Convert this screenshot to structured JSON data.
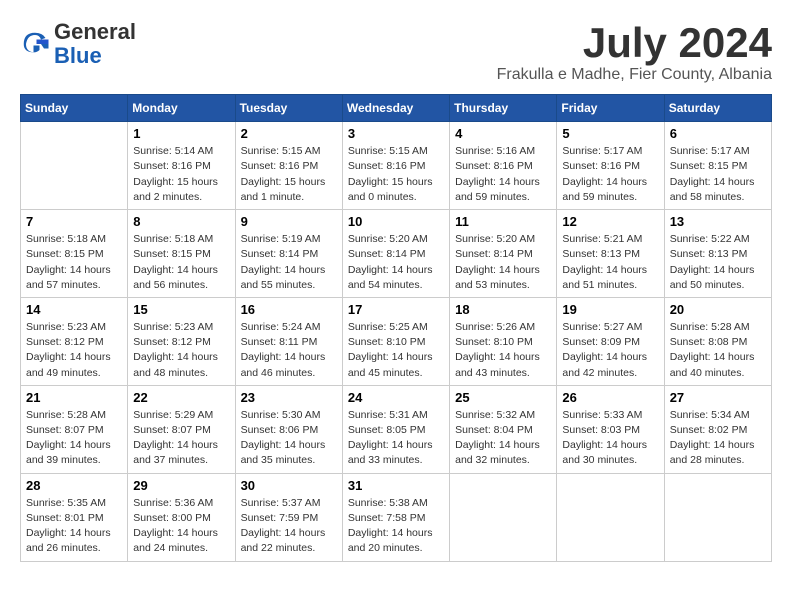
{
  "header": {
    "logo_general": "General",
    "logo_blue": "Blue",
    "month": "July 2024",
    "location": "Frakulla e Madhe, Fier County, Albania"
  },
  "days_of_week": [
    "Sunday",
    "Monday",
    "Tuesday",
    "Wednesday",
    "Thursday",
    "Friday",
    "Saturday"
  ],
  "weeks": [
    [
      {
        "day": "",
        "info": ""
      },
      {
        "day": "1",
        "info": "Sunrise: 5:14 AM\nSunset: 8:16 PM\nDaylight: 15 hours\nand 2 minutes."
      },
      {
        "day": "2",
        "info": "Sunrise: 5:15 AM\nSunset: 8:16 PM\nDaylight: 15 hours\nand 1 minute."
      },
      {
        "day": "3",
        "info": "Sunrise: 5:15 AM\nSunset: 8:16 PM\nDaylight: 15 hours\nand 0 minutes."
      },
      {
        "day": "4",
        "info": "Sunrise: 5:16 AM\nSunset: 8:16 PM\nDaylight: 14 hours\nand 59 minutes."
      },
      {
        "day": "5",
        "info": "Sunrise: 5:17 AM\nSunset: 8:16 PM\nDaylight: 14 hours\nand 59 minutes."
      },
      {
        "day": "6",
        "info": "Sunrise: 5:17 AM\nSunset: 8:15 PM\nDaylight: 14 hours\nand 58 minutes."
      }
    ],
    [
      {
        "day": "7",
        "info": "Sunrise: 5:18 AM\nSunset: 8:15 PM\nDaylight: 14 hours\nand 57 minutes."
      },
      {
        "day": "8",
        "info": "Sunrise: 5:18 AM\nSunset: 8:15 PM\nDaylight: 14 hours\nand 56 minutes."
      },
      {
        "day": "9",
        "info": "Sunrise: 5:19 AM\nSunset: 8:14 PM\nDaylight: 14 hours\nand 55 minutes."
      },
      {
        "day": "10",
        "info": "Sunrise: 5:20 AM\nSunset: 8:14 PM\nDaylight: 14 hours\nand 54 minutes."
      },
      {
        "day": "11",
        "info": "Sunrise: 5:20 AM\nSunset: 8:14 PM\nDaylight: 14 hours\nand 53 minutes."
      },
      {
        "day": "12",
        "info": "Sunrise: 5:21 AM\nSunset: 8:13 PM\nDaylight: 14 hours\nand 51 minutes."
      },
      {
        "day": "13",
        "info": "Sunrise: 5:22 AM\nSunset: 8:13 PM\nDaylight: 14 hours\nand 50 minutes."
      }
    ],
    [
      {
        "day": "14",
        "info": "Sunrise: 5:23 AM\nSunset: 8:12 PM\nDaylight: 14 hours\nand 49 minutes."
      },
      {
        "day": "15",
        "info": "Sunrise: 5:23 AM\nSunset: 8:12 PM\nDaylight: 14 hours\nand 48 minutes."
      },
      {
        "day": "16",
        "info": "Sunrise: 5:24 AM\nSunset: 8:11 PM\nDaylight: 14 hours\nand 46 minutes."
      },
      {
        "day": "17",
        "info": "Sunrise: 5:25 AM\nSunset: 8:10 PM\nDaylight: 14 hours\nand 45 minutes."
      },
      {
        "day": "18",
        "info": "Sunrise: 5:26 AM\nSunset: 8:10 PM\nDaylight: 14 hours\nand 43 minutes."
      },
      {
        "day": "19",
        "info": "Sunrise: 5:27 AM\nSunset: 8:09 PM\nDaylight: 14 hours\nand 42 minutes."
      },
      {
        "day": "20",
        "info": "Sunrise: 5:28 AM\nSunset: 8:08 PM\nDaylight: 14 hours\nand 40 minutes."
      }
    ],
    [
      {
        "day": "21",
        "info": "Sunrise: 5:28 AM\nSunset: 8:07 PM\nDaylight: 14 hours\nand 39 minutes."
      },
      {
        "day": "22",
        "info": "Sunrise: 5:29 AM\nSunset: 8:07 PM\nDaylight: 14 hours\nand 37 minutes."
      },
      {
        "day": "23",
        "info": "Sunrise: 5:30 AM\nSunset: 8:06 PM\nDaylight: 14 hours\nand 35 minutes."
      },
      {
        "day": "24",
        "info": "Sunrise: 5:31 AM\nSunset: 8:05 PM\nDaylight: 14 hours\nand 33 minutes."
      },
      {
        "day": "25",
        "info": "Sunrise: 5:32 AM\nSunset: 8:04 PM\nDaylight: 14 hours\nand 32 minutes."
      },
      {
        "day": "26",
        "info": "Sunrise: 5:33 AM\nSunset: 8:03 PM\nDaylight: 14 hours\nand 30 minutes."
      },
      {
        "day": "27",
        "info": "Sunrise: 5:34 AM\nSunset: 8:02 PM\nDaylight: 14 hours\nand 28 minutes."
      }
    ],
    [
      {
        "day": "28",
        "info": "Sunrise: 5:35 AM\nSunset: 8:01 PM\nDaylight: 14 hours\nand 26 minutes."
      },
      {
        "day": "29",
        "info": "Sunrise: 5:36 AM\nSunset: 8:00 PM\nDaylight: 14 hours\nand 24 minutes."
      },
      {
        "day": "30",
        "info": "Sunrise: 5:37 AM\nSunset: 7:59 PM\nDaylight: 14 hours\nand 22 minutes."
      },
      {
        "day": "31",
        "info": "Sunrise: 5:38 AM\nSunset: 7:58 PM\nDaylight: 14 hours\nand 20 minutes."
      },
      {
        "day": "",
        "info": ""
      },
      {
        "day": "",
        "info": ""
      },
      {
        "day": "",
        "info": ""
      }
    ]
  ]
}
